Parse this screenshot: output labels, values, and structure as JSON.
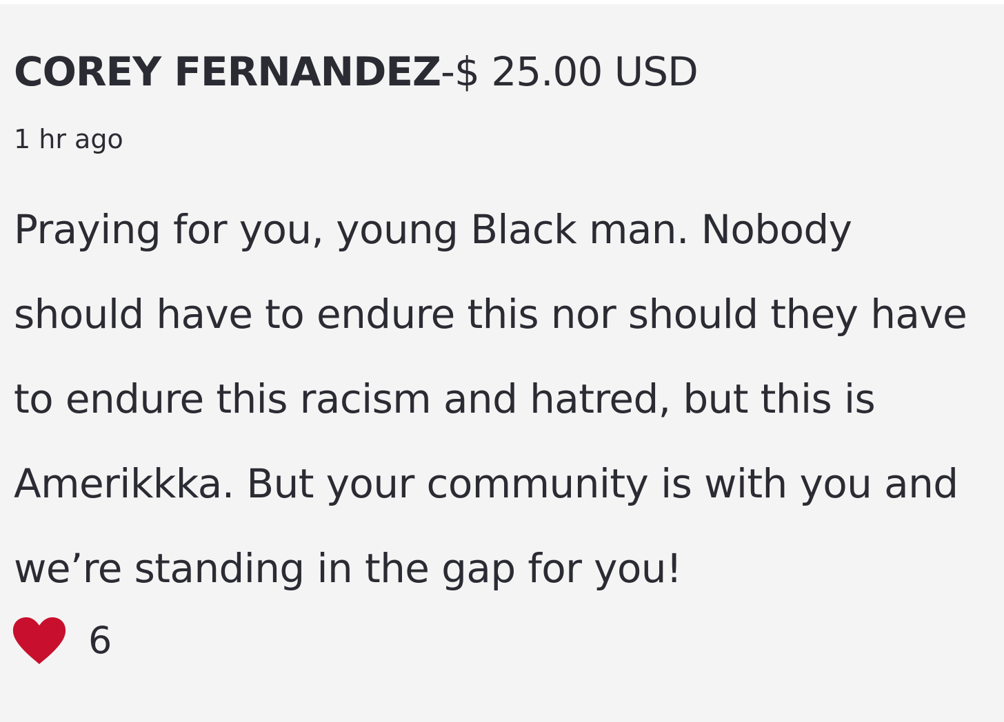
{
  "comment": {
    "donor_name": "COREY FERNANDEZ",
    "separator": "-",
    "amount": "$ 25.00 USD",
    "time_ago": "1 hr ago",
    "message": "Praying for you, young Black man. Nobody should have to endure this nor should they have to endure this racism and hatred, but this is Amerikkka. But your community is with you and we’re standing in the gap for you!",
    "like_icon": "heart-icon",
    "like_count": "6"
  },
  "colors": {
    "background": "#f4f4f4",
    "text": "#2b2b33",
    "heart": "#c8102e"
  }
}
